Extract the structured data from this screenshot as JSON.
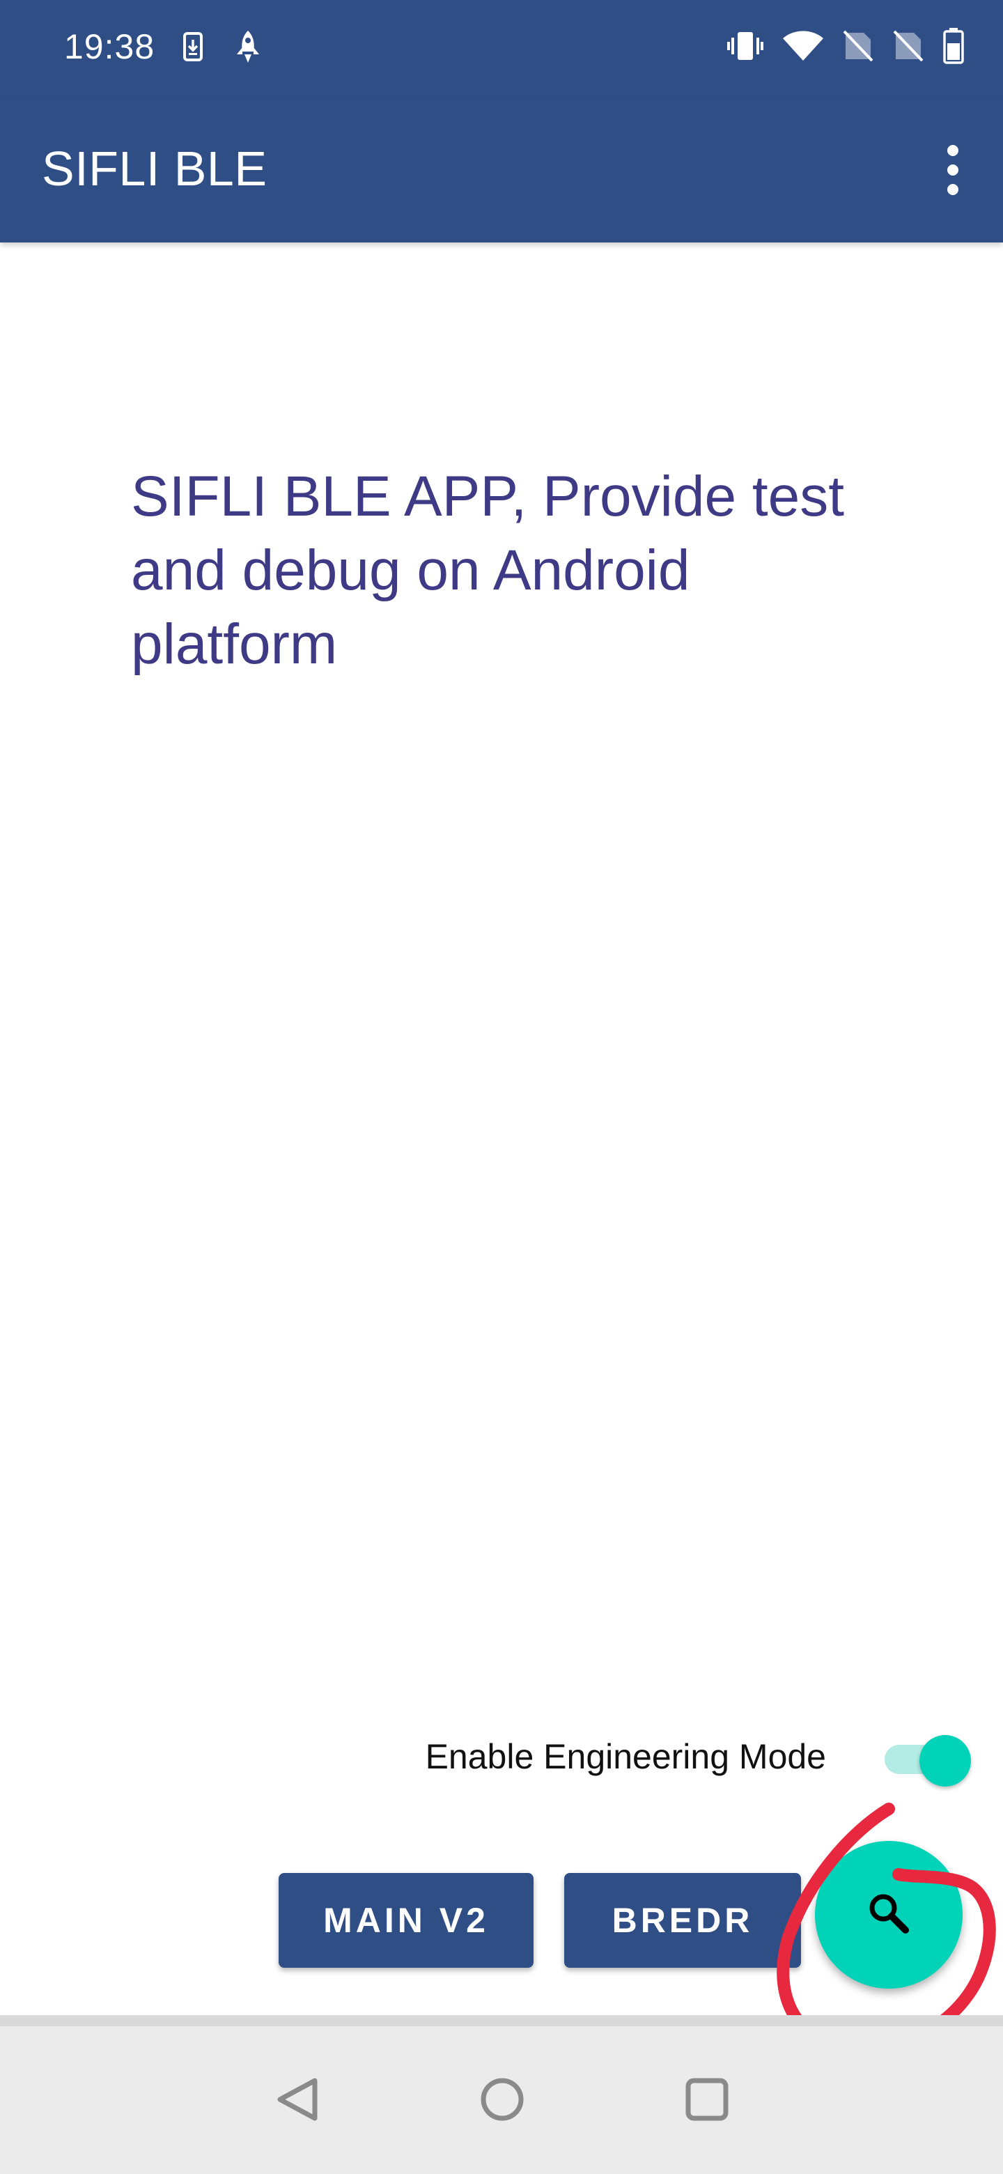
{
  "status_bar": {
    "time": "19:38",
    "left_icons": [
      "download-notification-icon",
      "rocket-icon"
    ],
    "right_icons": [
      "vibrate-icon",
      "wifi-icon",
      "no-sim-icon",
      "no-sim-icon",
      "battery-icon"
    ]
  },
  "app_bar": {
    "title": "SIFLI BLE",
    "menu_icon": "more-vert-icon"
  },
  "main": {
    "description": "SIFLI BLE APP, Provide test and debug on Android platform",
    "engineering_mode": {
      "label": "Enable Engineering Mode",
      "enabled": true
    },
    "buttons": {
      "main_v2": "MAIN V2",
      "bredr": "BREDR"
    },
    "fab_icon": "search-icon"
  },
  "navigation": {
    "icons": [
      "back-icon",
      "home-icon",
      "recents-icon"
    ]
  },
  "colors": {
    "primary": "#2f4e86",
    "accent": "#00d3b8",
    "text_primary": "#3f3a85",
    "annotation": "#e8283e"
  }
}
